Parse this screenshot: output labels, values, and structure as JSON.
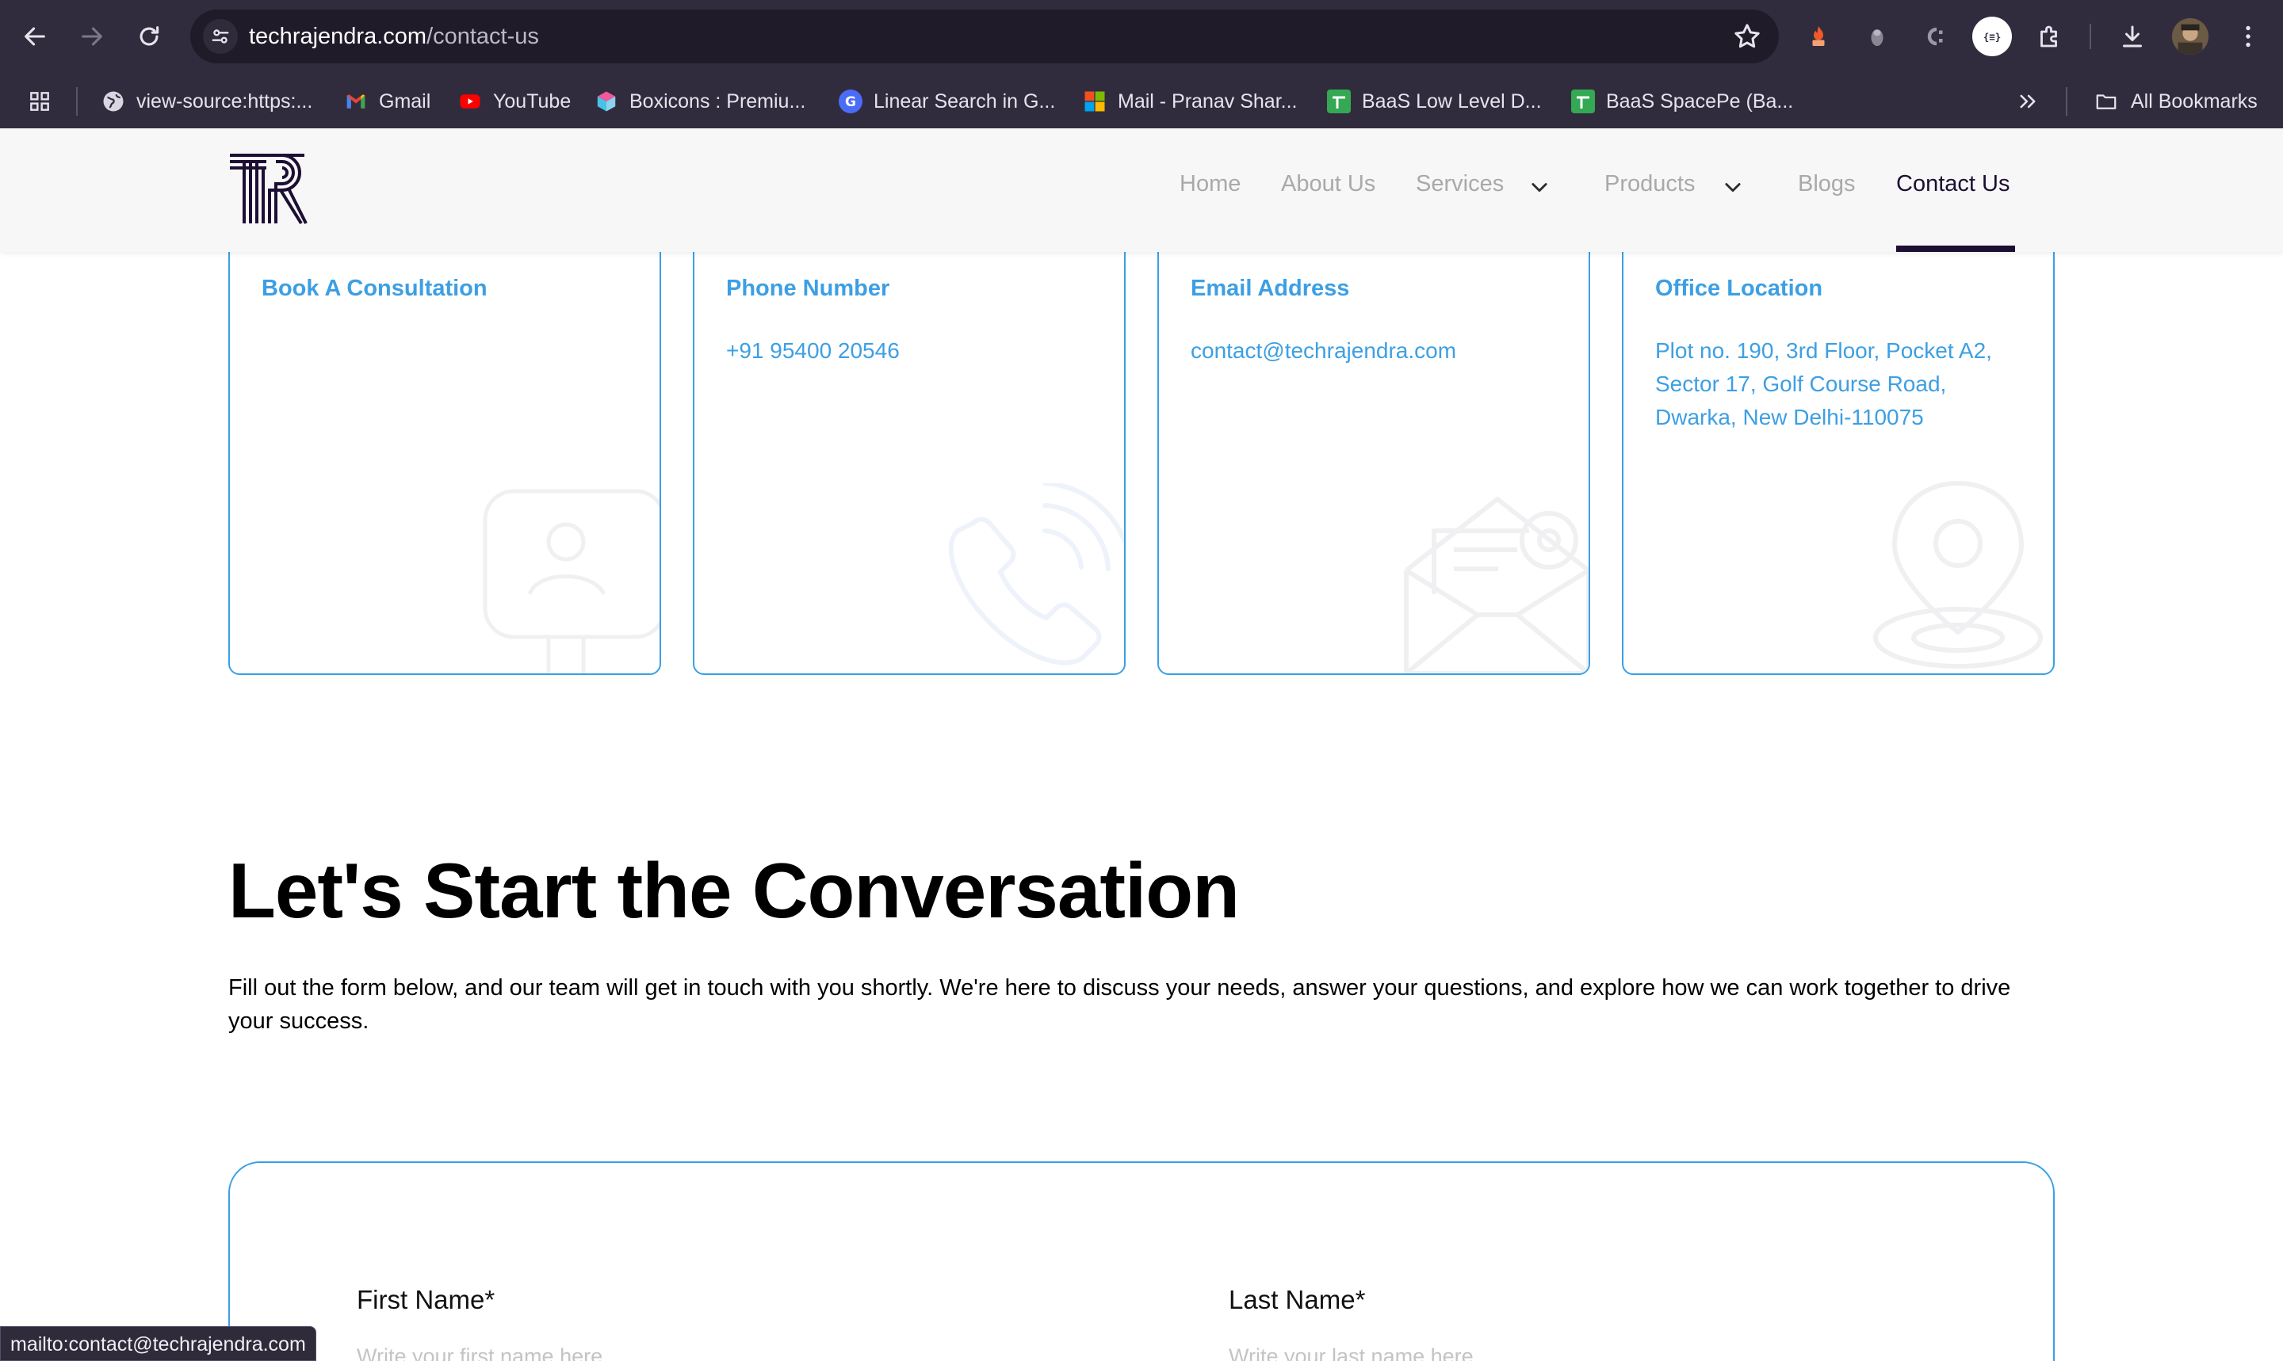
{
  "browser": {
    "url_host": "techrajendra.com",
    "url_path": "/contact-us",
    "bookmarks": [
      {
        "label": "view-source:https:...",
        "icon": "globe-icon"
      },
      {
        "label": "Gmail",
        "icon": "gmail-icon"
      },
      {
        "label": "YouTube",
        "icon": "youtube-icon"
      },
      {
        "label": "Boxicons : Premiu...",
        "icon": "boxicons-icon"
      },
      {
        "label": "Linear Search in G...",
        "icon": "google-icon"
      },
      {
        "label": "Mail - Pranav Shar...",
        "icon": "microsoft-icon"
      },
      {
        "label": "BaaS Low Level D...",
        "icon": "sheets-icon"
      },
      {
        "label": "BaaS SpacePe (Ba...",
        "icon": "sheets-icon"
      }
    ],
    "all_bookmarks_label": "All Bookmarks",
    "status_url": "mailto:contact@techrajendra.com"
  },
  "site": {
    "nav": {
      "home": "Home",
      "about": "About Us",
      "services": "Services",
      "products": "Products",
      "blogs": "Blogs",
      "contact": "Contact Us"
    },
    "accent_color": "#3d9fe3",
    "brand_color": "#1c0f33"
  },
  "cards": [
    {
      "title": "Book A Consultation",
      "value": "",
      "icon": "consultation-icon"
    },
    {
      "title": "Phone Number",
      "value": "+91 95400 20546",
      "icon": "phone-icon"
    },
    {
      "title": "Email Address",
      "value": "contact@techrajendra.com",
      "icon": "email-icon"
    },
    {
      "title": "Office Location",
      "value": "Plot no. 190, 3rd Floor, Pocket A2, Sector 17, Golf Course Road, Dwarka, New Delhi-110075",
      "icon": "location-icon"
    }
  ],
  "conversation": {
    "title": "Let's Start the Conversation",
    "text": "Fill out the form below, and our team will get in touch with you shortly. We're here to discuss your needs, answer your questions, and explore how we can work together to drive your success."
  },
  "form": {
    "first_name_label": "First Name*",
    "first_name_placeholder": "Write your first name here",
    "last_name_label": "Last Name*",
    "last_name_placeholder": "Write your last name here"
  }
}
